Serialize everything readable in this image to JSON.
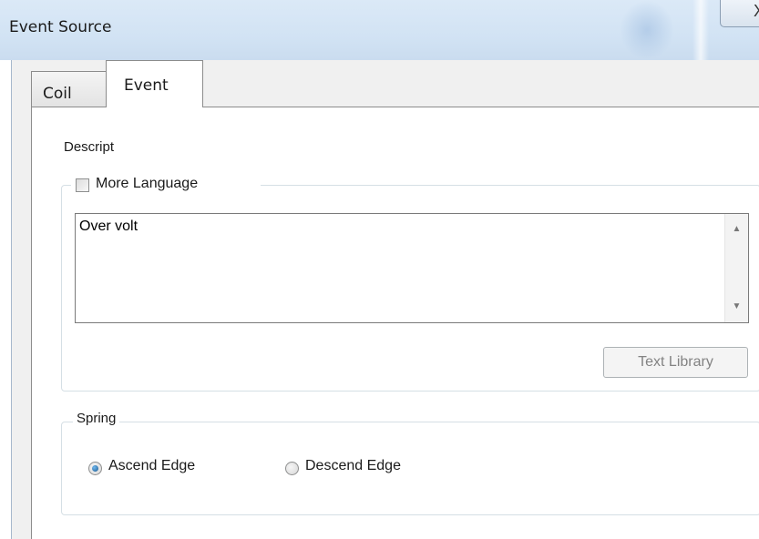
{
  "window": {
    "title": "Event Source",
    "close_glyph": "X"
  },
  "tabs": [
    {
      "label": "Coil",
      "active": false
    },
    {
      "label": "Event",
      "active": true
    }
  ],
  "descript": {
    "label": "Descript",
    "more_language_label": "More Language",
    "more_language_checked": false,
    "text_value": "Over volt",
    "text_library_button": "Text Library"
  },
  "spring": {
    "label": "Spring",
    "options": [
      {
        "label": "Ascend Edge",
        "selected": true
      },
      {
        "label": "Descend Edge",
        "selected": false
      }
    ]
  },
  "colors": {
    "title_bar": "#d2e3f4",
    "panel": "#ffffff",
    "dialog_bg": "#f0f0f0",
    "radio_selected": "#1c5a8f"
  }
}
